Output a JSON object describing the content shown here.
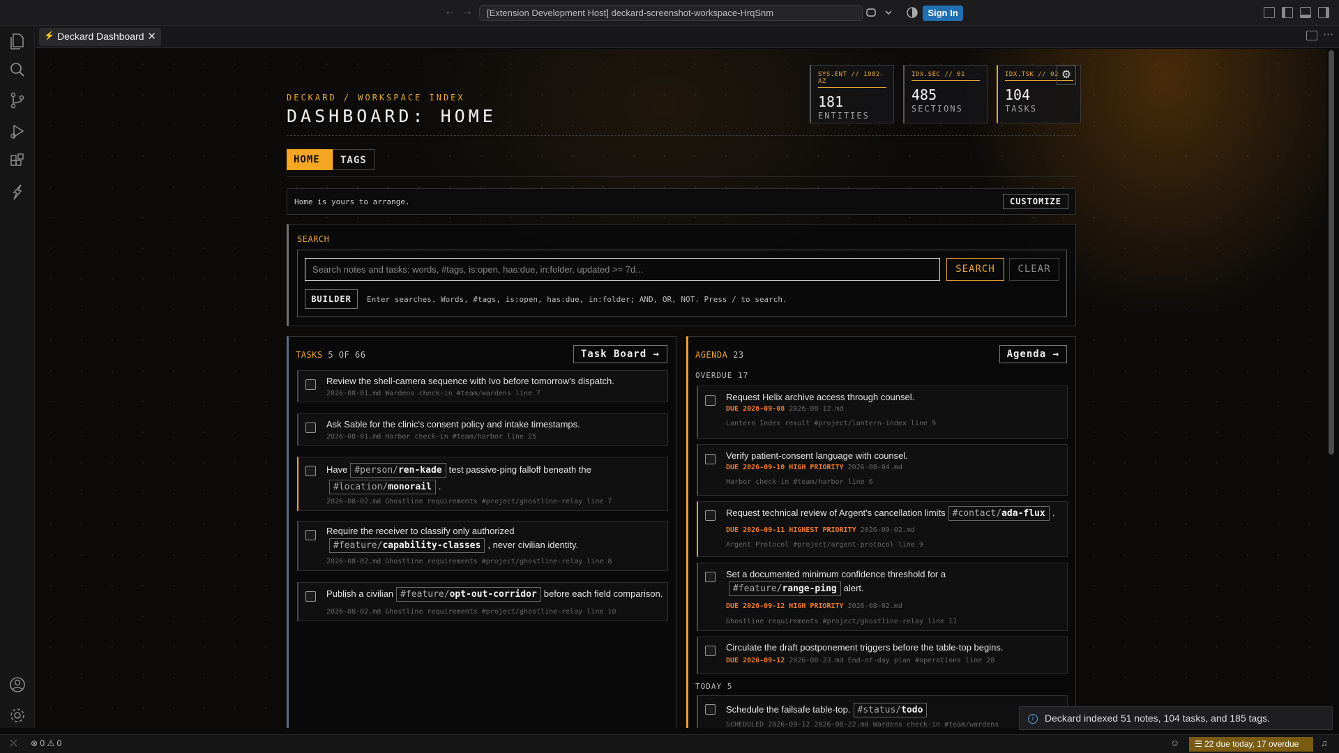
{
  "titlebar": {
    "command_center": "[Extension Development Host] deckard-screenshot-workspace-HrqSnm",
    "sign_in": "Sign In"
  },
  "tab": {
    "label": "Deckard Dashboard"
  },
  "header": {
    "breadcrumb": "DECKARD / WORKSPACE INDEX",
    "title": "DASHBOARD: HOME",
    "stats": [
      {
        "code": "SYS.ENT // 1982-AZ",
        "value": "181",
        "label": "ENTITIES"
      },
      {
        "code": "IDX.SEC // 01",
        "value": "485",
        "label": "SECTIONS"
      },
      {
        "code": "IDX.TSK // 02",
        "value": "104",
        "label": "TASKS"
      }
    ]
  },
  "nav": {
    "home": "HOME",
    "tags": "TAGS"
  },
  "arrange": {
    "text": "Home is yours to arrange.",
    "customize": "CUSTOMIZE"
  },
  "search": {
    "label": "SEARCH",
    "placeholder": "Search notes and tasks: words, #tags, is:open, has:due, in:folder, updated >= 7d...",
    "search_btn": "SEARCH",
    "clear_btn": "CLEAR",
    "builder_btn": "BUILDER",
    "hint": "Enter searches. Words, #tags, is:open, has:due, in:folder; AND, OR, NOT. Press / to search."
  },
  "tasks": {
    "title": "TASKS",
    "count": "5 OF 66",
    "button": "Task Board →",
    "items": [
      {
        "text": "Review the shell-camera sequence with Ivo before tomorrow's dispatch.",
        "meta": "2026-08-01.md Wardens check-in #team/wardens line 7"
      },
      {
        "text": "Ask Sable for the clinic's consent policy and intake timestamps.",
        "meta": "2026-08-01.md Harbor check-in #team/harbor line 25"
      },
      {
        "text_a": "Have",
        "tag1_p": "#person/",
        "tag1_v": "ren-kade",
        "text_b": "test passive-ping falloff beneath the",
        "tag2_p": "#location/",
        "tag2_v": "monorail",
        "text_c": ".",
        "meta": "2026-08-02.md Ghostline requirements #project/ghostline-relay line 7"
      },
      {
        "text_a": "Require the receiver to classify only authorized",
        "tag1_p": "#feature/",
        "tag1_v": "capability-classes",
        "text_b": ", never civilian identity.",
        "meta": "2026-08-02.md Ghostline requirements #project/ghostline-relay line 8"
      },
      {
        "text_a": "Publish a civilian",
        "tag1_p": "#feature/",
        "tag1_v": "opt-out-corridor",
        "text_b": "before each field comparison.",
        "meta": "2026-08-02.md Ghostline requirements #project/ghostline-relay line 10"
      }
    ]
  },
  "agenda": {
    "title": "AGENDA",
    "count": "23",
    "button": "Agenda →",
    "overdue_label": "OVERDUE 17",
    "today_label": "TODAY 5",
    "items": [
      {
        "text": "Request Helix archive access through counsel.",
        "due": "DUE 2026-09-08",
        "date": "2026-08-12.md",
        "meta": "Lantern Index result #project/lantern-index line 9"
      },
      {
        "text": "Verify patient-consent language with counsel.",
        "due": "DUE 2026-09-10 HIGH PRIORITY",
        "date": "2026-08-04.md",
        "meta": "Harbor check-in #team/harbor line 6"
      },
      {
        "text_a": "Request technical review of Argent's cancellation limits",
        "tag1_p": "#contact/",
        "tag1_v": "ada-flux",
        "text_b": ".",
        "due": "DUE 2026-09-11 HIGHEST PRIORITY",
        "date": "2026-09-02.md",
        "meta": "Argent Protocol #project/argent-protocol line 9"
      },
      {
        "text_a": "Set a documented minimum confidence threshold for a",
        "tag1_p": "#feature/",
        "tag1_v": "range-ping",
        "text_b": "alert.",
        "due": "DUE 2026-09-12 HIGH PRIORITY",
        "date": "2026-08-02.md",
        "meta": "Ghostline requirements #project/ghostline-relay line 11"
      },
      {
        "text": "Circulate the draft postponement triggers before the table-top begins.",
        "due": "DUE 2026-09-12",
        "date": "2026-08-23.md End-of-day plan #operations line 28"
      },
      {
        "text_a": "Schedule the failsafe table-top.",
        "tag1_p": "#status/",
        "tag1_v": "todo",
        "meta": "SCHEDULED 2026-09-12 2026-08-22.md Wardens check-in #team/wardens"
      }
    ]
  },
  "toast": {
    "text": "Deckard indexed 51 notes, 104 tasks, and 185 tags."
  },
  "statusbar": {
    "errors": "0",
    "warnings": "0",
    "due": "22 due today, 17 overdue"
  },
  "colors": {
    "accent": "#e9a532",
    "due": "#f07a2a",
    "sign_in": "#1f6fb2"
  }
}
